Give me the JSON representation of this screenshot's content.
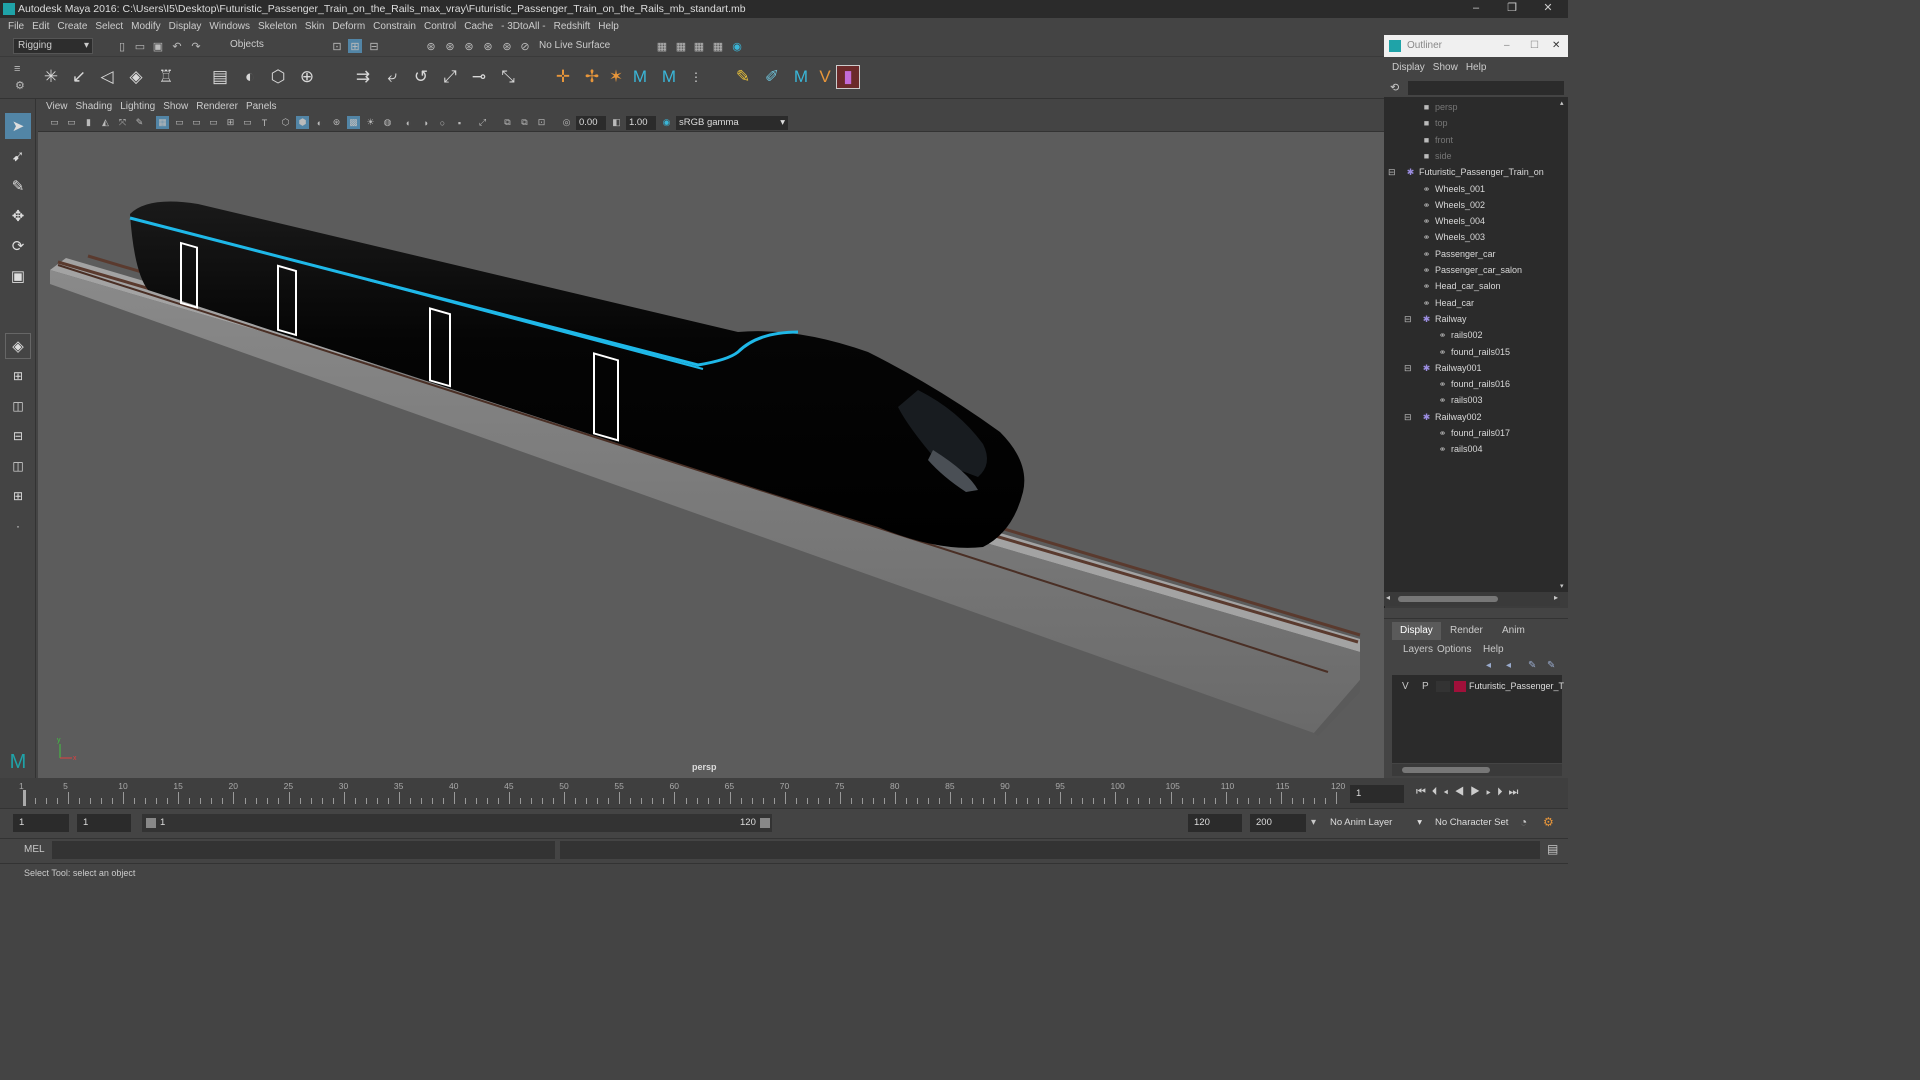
{
  "window": {
    "title": "Autodesk Maya 2016: C:\\Users\\I5\\Desktop\\Futuristic_Passenger_Train_on_the_Rails_max_vray\\Futuristic_Passenger_Train_on_the_Rails_mb_standart.mb",
    "minimize": "–",
    "maximize": "❐",
    "close": "✕"
  },
  "menu": [
    "File",
    "Edit",
    "Create",
    "Select",
    "Modify",
    "Display",
    "Windows",
    "Skeleton",
    "Skin",
    "Deform",
    "Constrain",
    "Control",
    "Cache",
    "- 3DtoAll -",
    "Redshift",
    "Help"
  ],
  "status": {
    "mode": "Rigging",
    "selection_mode": "Objects",
    "live_surface": "No Live Surface"
  },
  "viewport": {
    "menu": [
      "View",
      "Shading",
      "Lighting",
      "Show",
      "Renderer",
      "Panels"
    ],
    "exposure": "0.00",
    "gamma": "1.00",
    "color_space": "sRGB gamma",
    "camera_label": "persp",
    "axis_x": "x",
    "axis_y": "y"
  },
  "timeline": {
    "ticks": [
      "1",
      "5",
      "10",
      "15",
      "20",
      "25",
      "30",
      "35",
      "40",
      "45",
      "50",
      "55",
      "60",
      "65",
      "70",
      "75",
      "80",
      "85",
      "90",
      "95",
      "100",
      "105",
      "110",
      "115",
      "120"
    ],
    "current_frame": "1"
  },
  "range": {
    "start": "1",
    "playback_start": "1",
    "slider_start": "1",
    "slider_end": "120",
    "playback_end": "120",
    "end": "200",
    "anim_layer": "No Anim Layer",
    "character_set": "No Character Set"
  },
  "mel": {
    "label": "MEL"
  },
  "help_line": "Select Tool: select an object",
  "outliner": {
    "title": "Outliner",
    "menu": [
      "Display",
      "Show",
      "Help"
    ],
    "items": [
      {
        "label": "persp",
        "type": "camera",
        "depth": 0
      },
      {
        "label": "top",
        "type": "camera",
        "depth": 0
      },
      {
        "label": "front",
        "type": "camera",
        "depth": 0
      },
      {
        "label": "side",
        "type": "camera",
        "depth": 0
      },
      {
        "label": "Futuristic_Passenger_Train_on",
        "type": "group",
        "depth": 0
      },
      {
        "label": "Wheels_001",
        "type": "mesh",
        "depth": 1
      },
      {
        "label": "Wheels_002",
        "type": "mesh",
        "depth": 1
      },
      {
        "label": "Wheels_004",
        "type": "mesh",
        "depth": 1
      },
      {
        "label": "Wheels_003",
        "type": "mesh",
        "depth": 1
      },
      {
        "label": "Passenger_car",
        "type": "mesh",
        "depth": 1
      },
      {
        "label": "Passenger_car_salon",
        "type": "mesh",
        "depth": 1
      },
      {
        "label": "Head_car_salon",
        "type": "mesh",
        "depth": 1
      },
      {
        "label": "Head_car",
        "type": "mesh",
        "depth": 1
      },
      {
        "label": "Railway",
        "type": "group",
        "depth": 1
      },
      {
        "label": "rails002",
        "type": "mesh",
        "depth": 2
      },
      {
        "label": "found_rails015",
        "type": "mesh",
        "depth": 2
      },
      {
        "label": "Railway001",
        "type": "group",
        "depth": 1
      },
      {
        "label": "found_rails016",
        "type": "mesh",
        "depth": 2
      },
      {
        "label": "rails003",
        "type": "mesh",
        "depth": 2
      },
      {
        "label": "Railway002",
        "type": "group",
        "depth": 1
      },
      {
        "label": "found_rails017",
        "type": "mesh",
        "depth": 2
      },
      {
        "label": "rails004",
        "type": "mesh",
        "depth": 2
      }
    ]
  },
  "layers": {
    "tabs": [
      "Display",
      "Render",
      "Anim"
    ],
    "menu": [
      "Layers",
      "Options",
      "Help"
    ],
    "layer": {
      "v": "V",
      "p": "P",
      "name": "Futuristic_Passenger_T",
      "color": "#a0103a"
    }
  },
  "colors": {
    "accent": "#1fb8e8",
    "viewport_bg": "#5c5c5c"
  }
}
